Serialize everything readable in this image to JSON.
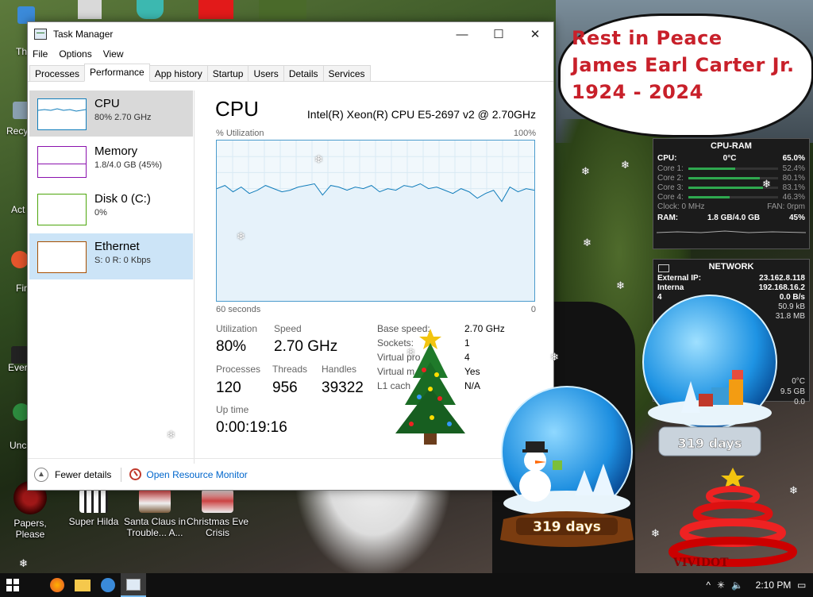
{
  "window": {
    "title": "Task Manager",
    "minimize": "—",
    "maximize": "☐",
    "close": "✕"
  },
  "menu": [
    "File",
    "Options",
    "View"
  ],
  "tabs": [
    "Processes",
    "Performance",
    "App history",
    "Startup",
    "Users",
    "Details",
    "Services"
  ],
  "sidebar": [
    {
      "name": "CPU",
      "sub": "80% 2.70 GHz"
    },
    {
      "name": "Memory",
      "sub": "1.8/4.0 GB (45%)"
    },
    {
      "name": "Disk 0 (C:)",
      "sub": "0%"
    },
    {
      "name": "Ethernet",
      "sub": "S: 0 R: 0 Kbps"
    }
  ],
  "cpu": {
    "heading": "CPU",
    "model": "Intel(R) Xeon(R) CPU E5-2697 v2 @ 2.70GHz",
    "util_label": "% Utilization",
    "util_max": "100%",
    "span_label": "60 seconds",
    "span_min": "0",
    "history": [
      70,
      72,
      68,
      71,
      67,
      69,
      72,
      70,
      68,
      69,
      71,
      72,
      73,
      66,
      72,
      71,
      69,
      71,
      70,
      72,
      68,
      70,
      69,
      72,
      71,
      73,
      70,
      71,
      69,
      67,
      70,
      68,
      64,
      67,
      69,
      62,
      71,
      68,
      70,
      69
    ],
    "stats": {
      "utilization_label": "Utilization",
      "utilization": "80%",
      "speed_label": "Speed",
      "speed": "2.70 GHz",
      "processes_label": "Processes",
      "processes": "120",
      "threads_label": "Threads",
      "threads": "956",
      "handles_label": "Handles",
      "handles": "39322",
      "uptime_label": "Up time",
      "uptime": "0:00:19:16"
    },
    "details": [
      {
        "label": "Base speed:",
        "value": "2.70 GHz"
      },
      {
        "label": "Sockets:",
        "value": "1"
      },
      {
        "label": "Virtual pro",
        "value": "4"
      },
      {
        "label": "Virtual m",
        "value": "Yes"
      },
      {
        "label": "L1 cach",
        "value": "N/A"
      }
    ]
  },
  "footer": {
    "fewer": "Fewer details",
    "resmon": "Open Resource Monitor"
  },
  "desktop_icons": [
    {
      "label": "Papers, Please"
    },
    {
      "label": "Super Hilda"
    },
    {
      "label": "Santa Claus in Trouble... A..."
    },
    {
      "label": "Christmas Eve Crisis"
    }
  ],
  "left_labels": [
    "Th",
    "Recy",
    "Act",
    "Fir",
    "Ever",
    "Unc"
  ],
  "sticker": {
    "line1": "Rest in Peace",
    "line2": "James Earl Carter Jr.",
    "line3": "1924 - 2024"
  },
  "gadget_cpu": {
    "title": "CPU-RAM",
    "cpu_label": "CPU:",
    "cpu_temp": "0°C",
    "cpu_pct": "65.0%",
    "cores": [
      {
        "label": "Core 1:",
        "value": "52.4%",
        "pct": 52.4
      },
      {
        "label": "Core 2:",
        "value": "80.1%",
        "pct": 80.1
      },
      {
        "label": "Core 3:",
        "value": "83.1%",
        "pct": 83.1
      },
      {
        "label": "Core 4:",
        "value": "46.3%",
        "pct": 46.3
      }
    ],
    "clock": "Clock: 0 MHz",
    "fan": "FAN: 0rpm",
    "ram_label": "RAM:",
    "ram_value": "1.8 GB/4.0 GB",
    "ram_pct": "45%"
  },
  "gadget_net": {
    "title": "NETWORK",
    "ext_label": "External IP:",
    "ext_ip": "23.162.8.118",
    "int_label": "Interna",
    "int_ip": "192.168.16.2",
    "row3_label": "4",
    "row3": "0.0 B/s",
    "row4": "50.9 kB",
    "row5": "31.8 MB"
  },
  "gadget_misc": {
    "temp": "0°C",
    "size": "9.5 GB",
    "val": "0.0"
  },
  "globes": {
    "left_days": "319 days",
    "right_days": "319 days"
  },
  "watermark": "VIVIDOT",
  "taskbar": {
    "time": "2:10 PM"
  },
  "colors": {
    "accent": "#0078d7",
    "graph_line": "#117dbb",
    "mem": "#8b12ae",
    "disk": "#4da60c",
    "eth": "#a74f01",
    "rip": "#c8202a"
  }
}
